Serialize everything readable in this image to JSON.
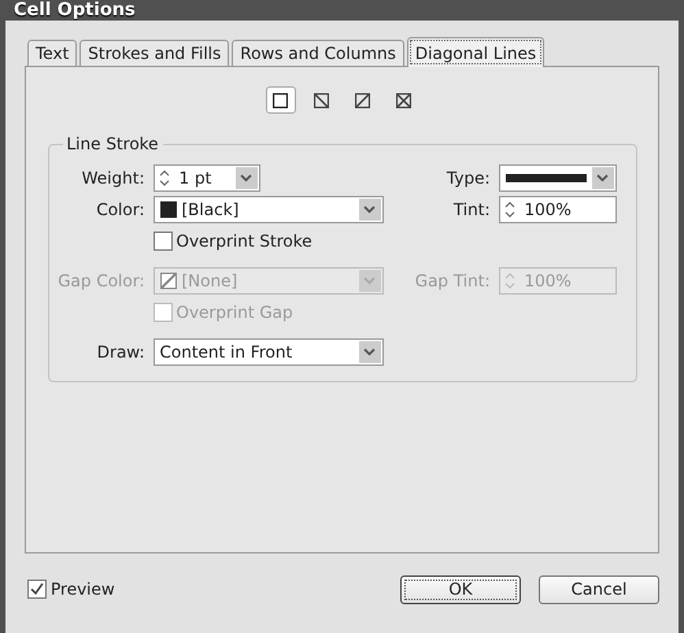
{
  "window": {
    "title": "Cell Options"
  },
  "tabs": [
    {
      "label": "Text",
      "selected": false
    },
    {
      "label": "Strokes and Fills",
      "selected": false
    },
    {
      "label": "Rows and Columns",
      "selected": false
    },
    {
      "label": "Diagonal Lines",
      "selected": true
    }
  ],
  "line_options": [
    {
      "kind": "none",
      "selected": true
    },
    {
      "kind": "down",
      "selected": false
    },
    {
      "kind": "up",
      "selected": false
    },
    {
      "kind": "cross",
      "selected": false
    }
  ],
  "group": {
    "title": "Line Stroke",
    "rows": [
      {
        "left": {
          "kind": "spinner-dropdown",
          "label": "Weight:",
          "value": "1 pt",
          "disabled": false
        },
        "right": {
          "kind": "stroke-type",
          "label": "Type:",
          "disabled": false
        }
      },
      {
        "left": {
          "kind": "swatch-dropdown",
          "label": "Color:",
          "value": "[Black]",
          "swatch_empty": false,
          "disabled": false
        },
        "right": {
          "kind": "spinner",
          "label": "Tint:",
          "value": "100%",
          "disabled": false
        }
      },
      {
        "left": {
          "kind": "checkbox",
          "label": "Overprint Stroke",
          "checked": false,
          "disabled": false
        }
      },
      {
        "left": {
          "kind": "swatch-dropdown",
          "label": "Gap Color:",
          "value": "[None]",
          "swatch_empty": true,
          "disabled": true
        },
        "right": {
          "kind": "spinner",
          "label": "Gap Tint:",
          "value": "100%",
          "disabled": true
        }
      },
      {
        "left": {
          "kind": "checkbox",
          "label": "Overprint Gap",
          "checked": false,
          "disabled": true
        }
      },
      {
        "left": {
          "kind": "dropdown",
          "label": "Draw:",
          "value": "Content in Front",
          "disabled": false
        }
      }
    ]
  },
  "preview": {
    "label": "Preview",
    "checked": true
  },
  "buttons": [
    {
      "label": "OK",
      "kind": "default"
    },
    {
      "label": "Cancel",
      "kind": "normal"
    }
  ]
}
